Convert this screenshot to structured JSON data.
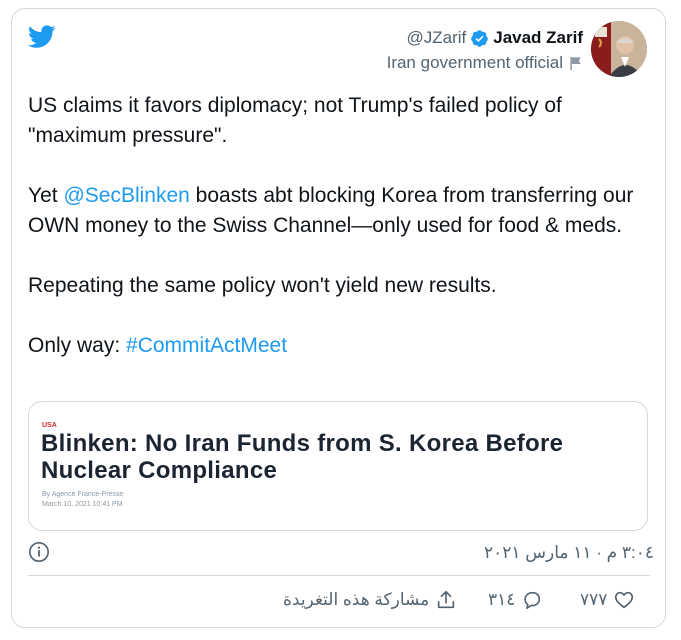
{
  "author": {
    "handle": "@JZarif",
    "display_name": "Javad Zarif",
    "affiliation": "Iran government official"
  },
  "tweet": {
    "para1": "US claims it favors diplomacy; not Trump's failed policy of \"maximum pressure\".",
    "para2_prefix": "Yet ",
    "para2_mention": "@SecBlinken",
    "para2_rest": " boasts abt blocking Korea from transferring our OWN money to the Swiss Channel—only used for food & meds.",
    "para3": "Repeating the same policy won't yield new results.",
    "para4_prefix": "Only way: ",
    "para4_hashtag": "#CommitActMeet"
  },
  "embed": {
    "kicker": "USA",
    "title": "Blinken: No Iran Funds from S. Korea Before Nuclear Compliance",
    "byline": "By Agence France-Presse",
    "date": "March 10, 2021 10:41 PM"
  },
  "meta": {
    "timestamp": "٣:٠٤ م · ١١ مارس ٢٠٢١"
  },
  "actions": {
    "likes": "٧٧٧",
    "replies": "٣١٤",
    "share_label": "مشاركة هذه التغريدة"
  },
  "colors": {
    "brand_blue": "#1d9bf0",
    "text": "#0f1419",
    "muted": "#536471",
    "border": "#cfd9de"
  },
  "icons": [
    "twitter-bird-icon",
    "verified-badge-icon",
    "flag-icon",
    "info-icon",
    "heart-icon",
    "reply-icon",
    "share-icon"
  ]
}
